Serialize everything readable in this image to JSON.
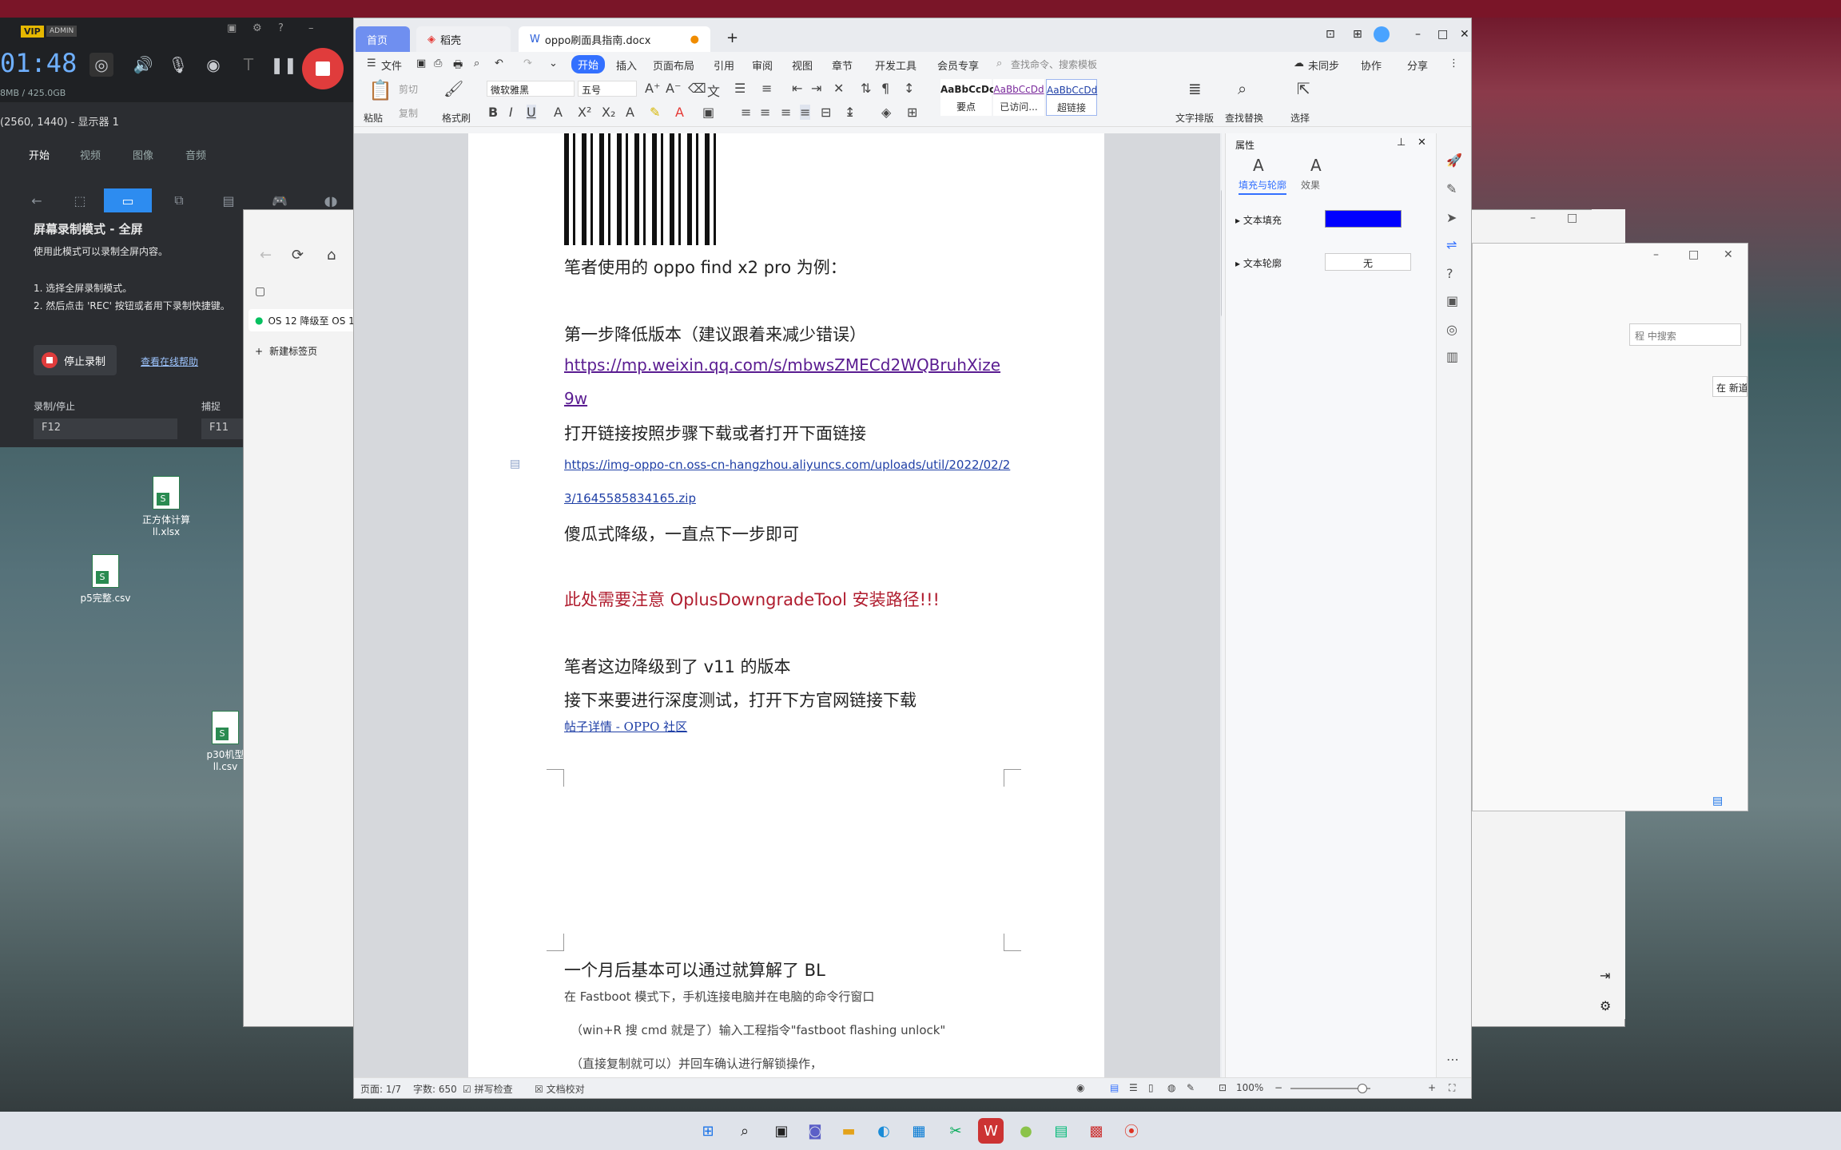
{
  "recorder": {
    "vip": "VIP",
    "admin": "ADMIN",
    "timer": "01:48",
    "size": "8MB / 425.0GB",
    "resolution": "(2560, 1440) - 显示器 1",
    "tabs": [
      "开始",
      "视频",
      "图像",
      "音频"
    ],
    "mode_title": "屏幕录制模式 - 全屏",
    "mode_desc": "使用此模式可以录制全屏内容。",
    "steps": [
      "1. 选择全屏录制模式。",
      "2. 然后点击 'REC' 按钮或者用下录制快捷键。"
    ],
    "stop_label": "停止录制",
    "help_link": "查看在线帮助",
    "hotkey1_label": "录制/停止",
    "hotkey1": "F12",
    "hotkey2_label": "捕捉",
    "hotkey2": "F11"
  },
  "desktop": {
    "icons": [
      {
        "label": "正方体计算ll.xlsx"
      },
      {
        "label": "p5完整.csv"
      },
      {
        "label": "p30机型ll.csv"
      }
    ]
  },
  "browser": {
    "tab": "OS 12 降级至 OS 1",
    "new_tab": "新建标签页",
    "search_placeholder": "程 中搜索",
    "search2": "在 新道"
  },
  "wps": {
    "tabs": {
      "home": "首页",
      "daoke": "稻壳",
      "doc": "oppo刷面具指南.docx"
    },
    "menu": {
      "file": "文件",
      "start": "开始",
      "insert": "插入",
      "layout": "页面布局",
      "ref": "引用",
      "review": "审阅",
      "view": "视图",
      "chapter": "章节",
      "dev": "开发工具",
      "member": "会员专享",
      "search": "查找命令、搜索模板",
      "unsync": "未同步",
      "collab": "协作",
      "share": "分享"
    },
    "ribbon": {
      "paste": "粘贴",
      "cut": "剪切",
      "copy": "复制",
      "format_brush": "格式刷",
      "font": "微软雅黑",
      "size": "五号",
      "styles": [
        {
          "sample": "AaBbCcDc",
          "name": "要点"
        },
        {
          "sample": "AaBbCcDd",
          "name": "已访问..."
        },
        {
          "sample": "AaBbCcDd",
          "name": "超链接"
        }
      ],
      "text_layout": "文字排版",
      "find_replace": "查找替换",
      "select": "选择"
    },
    "doc": {
      "line1": "笔者使用的 oppo find x2 pro 为例：",
      "line2": "第一步降低版本（建议跟着来减少错误）",
      "link1a": "https://mp.weixin.qq.com/s/mbwsZMECd2WQBruhXize",
      "link1b": "9w",
      "line3": "打开链接按照步骤下载或者打开下面链接",
      "link2a": "https://img-oppo-cn.oss-cn-hangzhou.aliyuncs.com/uploads/util/2022/02/2",
      "link2b": "3/1645585834165.zip",
      "line4": "傻瓜式降级，一直点下一步即可",
      "warning": "此处需要注意 OplusDowngradeTool 安装路径!!!",
      "line5": "笔者这边降级到了 v11 的版本",
      "line6": "接下来要进行深度测试，打开下方官网链接下载",
      "link3": "帖子详情 - OPPO 社区",
      "p2_line1": "一个月后基本可以通过就算解了 BL",
      "p2_line2": "在 Fastboot 模式下，手机连接电脑并在电脑的命令行窗口",
      "p2_line3": "（win+R 搜 cmd 就是了）输入工程指令\"fastboot flashing unlock\"",
      "p2_line4": "（直接复制就可以）并回车确认进行解锁操作，"
    },
    "props": {
      "title": "属性",
      "tab1": "填充与轮廓",
      "tab2": "效果",
      "fill_label": "文本填充",
      "fill_color": "#0000ff",
      "outline_label": "文本轮廓",
      "outline_value": "无"
    },
    "status": {
      "page": "页面: 1/7",
      "words": "字数: 650",
      "spell": "拼写检查",
      "proof": "文档校对",
      "zoom": "100%"
    }
  }
}
